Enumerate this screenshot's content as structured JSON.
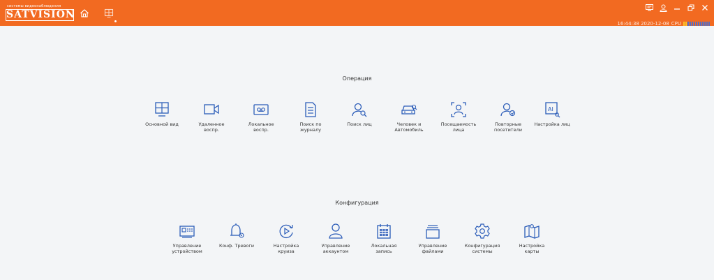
{
  "header": {
    "logo_tagline": "системы видеонаблюдения",
    "logo_text": "SATVISION",
    "timestamp": "16:44:38 2020-12-08",
    "cpu_label": "CPU",
    "accent_color": "#f26a21",
    "icon_color": "#2b5cb8"
  },
  "operations": {
    "title": "Операция",
    "items": [
      {
        "label": "Основной вид"
      },
      {
        "label": "Удаленное\nвоспр."
      },
      {
        "label": "Локальное\nвоспр."
      },
      {
        "label": "Поиск по\nжурналу"
      },
      {
        "label": "Поиск лиц"
      },
      {
        "label": "Человек и\nАвтомобиль"
      },
      {
        "label": "Посещаемость\nлица"
      },
      {
        "label": "Повторные\nпосетители"
      },
      {
        "label": "Настройка лиц"
      }
    ]
  },
  "configuration": {
    "title": "Конфигурация",
    "items": [
      {
        "label": "Управление\nустройством"
      },
      {
        "label": "Конф. Тревоги"
      },
      {
        "label": "Настройка\nкруиза"
      },
      {
        "label": "Управление\nаккаунтом"
      },
      {
        "label": "Локальная\nзапись"
      },
      {
        "label": "Управление\nфайлами"
      },
      {
        "label": "Конфигурация\nсистемы"
      },
      {
        "label": "Настройка\nкарты"
      }
    ]
  }
}
